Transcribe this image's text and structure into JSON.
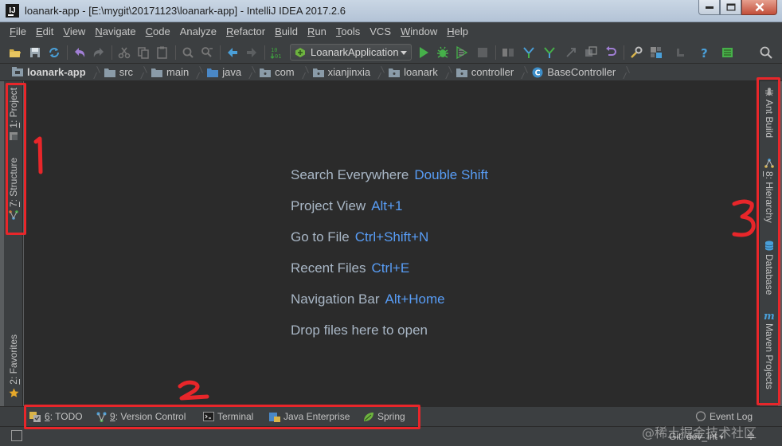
{
  "window": {
    "title": "loanark-app - [E:\\mygit\\20171123\\loanark-app] - IntelliJ IDEA 2017.2.6",
    "controls": [
      "minimize",
      "maximize",
      "close"
    ]
  },
  "menu": [
    {
      "mn": "F",
      "rest": "ile"
    },
    {
      "mn": "E",
      "rest": "dit"
    },
    {
      "mn": "V",
      "rest": "iew"
    },
    {
      "mn": "N",
      "rest": "avigate"
    },
    {
      "mn": "C",
      "rest": "ode"
    },
    {
      "mn": "",
      "rest": "Analyze"
    },
    {
      "mn": "R",
      "rest": "efactor"
    },
    {
      "mn": "B",
      "rest": "uild"
    },
    {
      "mn": "R",
      "rest": "un"
    },
    {
      "mn": "T",
      "rest": "ools"
    },
    {
      "mn": "",
      "rest": "VCS"
    },
    {
      "mn": "W",
      "rest": "indow"
    },
    {
      "mn": "H",
      "rest": "elp"
    }
  ],
  "toolbar": {
    "run_config": "LoanarkApplication"
  },
  "breadcrumb": [
    {
      "label": "loanark-app",
      "icon": "module-icon"
    },
    {
      "label": "src",
      "icon": "folder-icon"
    },
    {
      "label": "main",
      "icon": "folder-icon"
    },
    {
      "label": "java",
      "icon": "source-folder-icon"
    },
    {
      "label": "com",
      "icon": "folder-icon"
    },
    {
      "label": "xianjinxia",
      "icon": "package-icon"
    },
    {
      "label": "loanark",
      "icon": "package-icon"
    },
    {
      "label": "controller",
      "icon": "package-icon"
    },
    {
      "label": "BaseController",
      "icon": "class-icon"
    }
  ],
  "left_tabs": [
    {
      "mn": "1",
      "label": ": Project"
    },
    {
      "mn": "7",
      "label": ": Structure"
    },
    {
      "mn": "2",
      "label": ": Favorites"
    }
  ],
  "right_tabs": [
    {
      "label": "Ant Build"
    },
    {
      "mn": "8",
      "label": ": Hierarchy"
    },
    {
      "label": "Database"
    },
    {
      "label": "Maven Projects"
    }
  ],
  "editor_hints": [
    {
      "text": "Search Everywhere",
      "key": "Double Shift"
    },
    {
      "text": "Project View",
      "key": "Alt+1"
    },
    {
      "text": "Go to File",
      "key": "Ctrl+Shift+N"
    },
    {
      "text": "Recent Files",
      "key": "Ctrl+E"
    },
    {
      "text": "Navigation Bar",
      "key": "Alt+Home"
    },
    {
      "text": "Drop files here to open",
      "key": ""
    }
  ],
  "bottom_tabs": [
    {
      "mn": "6",
      "label": ": TODO"
    },
    {
      "mn": "9",
      "label": ": Version Control"
    },
    {
      "label": "Terminal"
    },
    {
      "label": "Java Enterprise"
    },
    {
      "label": "Spring"
    }
  ],
  "event_log": "Event Log",
  "status": {
    "git_branch": "Git: dev_int",
    "extra": "≑"
  },
  "watermark": "@稀土掘金技术社区",
  "colors": {
    "editor_bg": "#2b2b2b",
    "panel_bg": "#3c3f41",
    "hint_key": "#589df6",
    "annotation": "#e8262a"
  }
}
